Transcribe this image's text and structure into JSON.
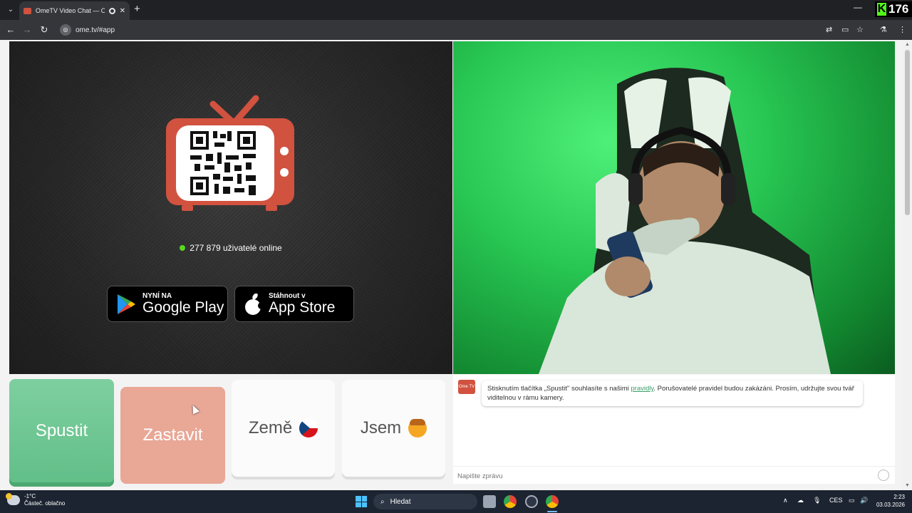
{
  "browser": {
    "tab_title": "OmeTV Video Chat — Ome",
    "tab_close": "✕",
    "new_tab": "+",
    "url": "ome.tv/#app",
    "minimize": "—",
    "kick_badge": "176"
  },
  "page": {
    "users_online": "277 879 uživatelé online",
    "google_play": {
      "small": "NYNÍ NA",
      "big": "Google Play"
    },
    "app_store": {
      "small": "Stáhnout v",
      "big": "App Store"
    },
    "colors": {
      "brand_red": "#d0523f",
      "start_green": "#6fc793",
      "stop_salmon": "#e9a796",
      "online_green": "#5ad820"
    }
  },
  "controls": {
    "start": "Spustit",
    "stop": "Zastavit",
    "country": "Země",
    "gender": "Jsem"
  },
  "chat": {
    "logo_text": "Ome TV",
    "message_before": "Stisknutím tlačítka „Spustit\" souhlasíte s našimi ",
    "message_link": "pravidly",
    "message_after": ". Porušovatelé pravidel budou zakázáni. Prosím, udržujte svou tvář viditelnou v rámu kamery.",
    "input_placeholder": "Napište zprávu"
  },
  "taskbar": {
    "weather_temp": "-1°C",
    "weather_desc": "Částeč. oblačno",
    "search": "Hledat",
    "lang": "CES",
    "time": "2:23",
    "date": "03.03.2026"
  }
}
